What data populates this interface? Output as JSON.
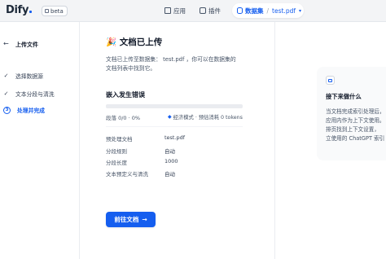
{
  "topbar": {
    "logo": "Dify",
    "badge": "beta",
    "nav": {
      "apps": "应用",
      "plugins": "插件",
      "datasets": "数据集",
      "separator": "/",
      "current_file": "test.pdf"
    }
  },
  "sidebar": {
    "back": "←",
    "title": "上传文件",
    "steps": [
      {
        "label": "选择数据源",
        "marker": "✓"
      },
      {
        "label": "文本分段与清洗",
        "marker": "✓"
      },
      {
        "label": "处理并完成",
        "marker": "3"
      }
    ]
  },
  "main": {
    "emoji": "🎉",
    "title": "文档已上传",
    "desc_lines": [
      "文档已上传至数据集： test.pdf ，你可以在数据集的",
      "文档列表中找到它。"
    ],
    "embedding_title": "嵌入发生错误",
    "progress": 0,
    "segments": "段落 0/0 · 0%",
    "mode": "经济模式 · 预估消耗 0 tokens",
    "details": [
      {
        "key": "预处理文档",
        "value": "test.pdf"
      },
      {
        "key": "分段规则",
        "value": "自动"
      },
      {
        "key": "分段长度",
        "value": "1000"
      },
      {
        "key": "文本预定义与清洗",
        "value": "自动"
      }
    ],
    "goto_button": "前往文档",
    "goto_arrow": "→"
  },
  "tip": {
    "title": "接下来做什么",
    "lines": [
      "当文档完成索引处理后，",
      "应用内作为上下文使用。",
      "排页找到上下文设置，",
      "立使用的 ChatGPT 索引"
    ]
  },
  "colors": {
    "accent": "#155eef",
    "text": "#101828",
    "muted": "#475467"
  }
}
